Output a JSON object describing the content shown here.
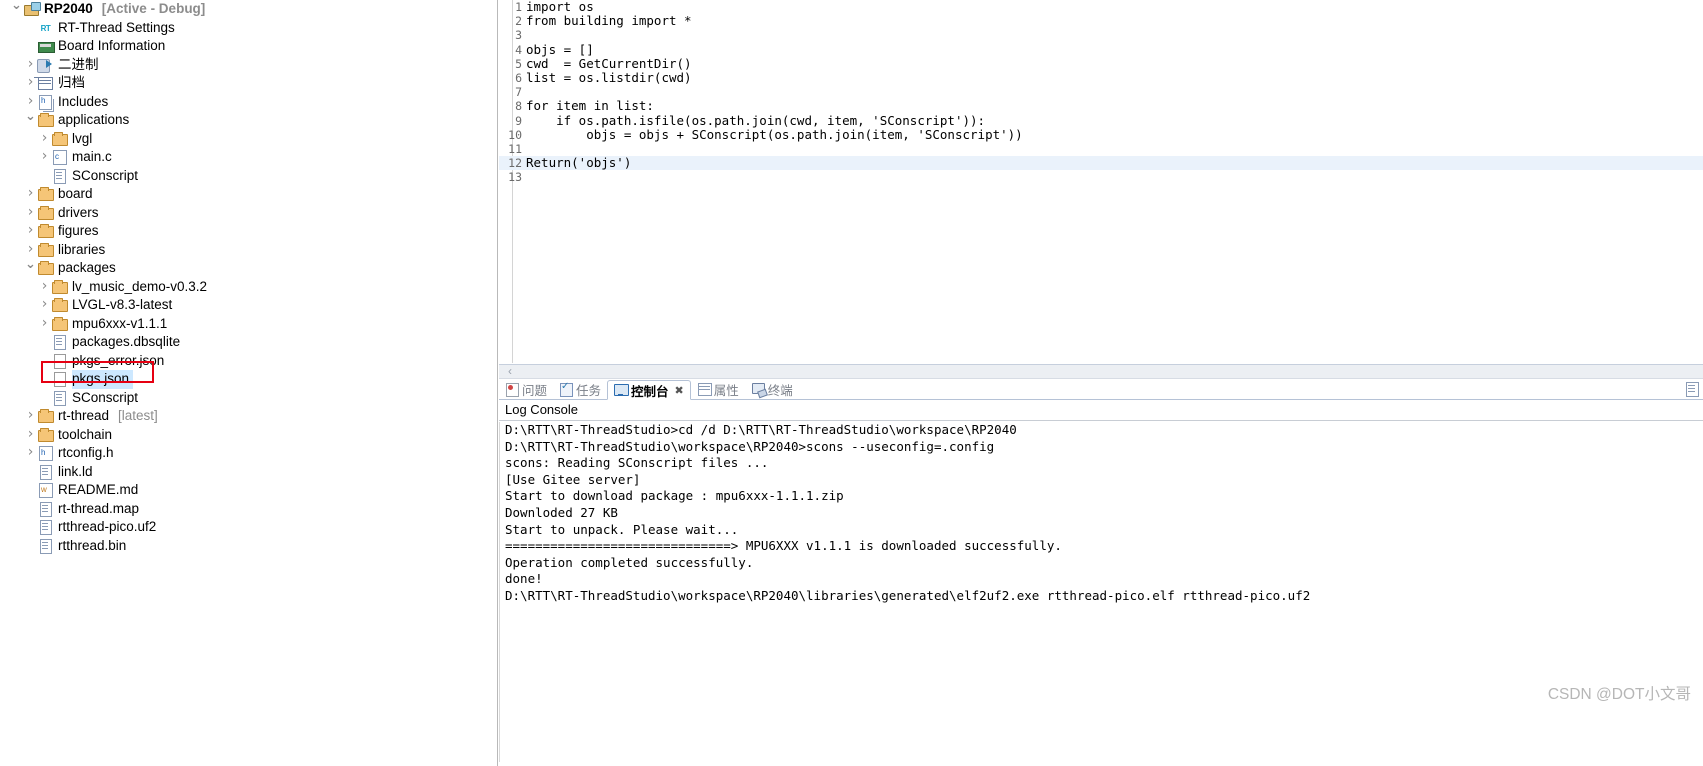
{
  "explorer": {
    "nodes": [
      {
        "depth": 0,
        "arrow": "open",
        "icon": "project-icon",
        "label": "RP2040",
        "suffix": "[Active - Debug]",
        "bold": true,
        "selected": false
      },
      {
        "depth": 1,
        "arrow": "none",
        "icon": "rt-thread-icon",
        "label": "RT-Thread Settings",
        "suffix": "",
        "bold": false,
        "selected": false
      },
      {
        "depth": 1,
        "arrow": "none",
        "icon": "board-icon",
        "label": "Board Information",
        "suffix": "",
        "bold": false,
        "selected": false
      },
      {
        "depth": 1,
        "arrow": "closed",
        "icon": "binary-icon",
        "label": "二进制",
        "suffix": "",
        "bold": false,
        "selected": false
      },
      {
        "depth": 1,
        "arrow": "closed",
        "icon": "archive-icon",
        "label": "归档",
        "suffix": "",
        "bold": false,
        "selected": false
      },
      {
        "depth": 1,
        "arrow": "closed",
        "icon": "includes-icon",
        "label": "Includes",
        "suffix": "",
        "bold": false,
        "selected": false
      },
      {
        "depth": 1,
        "arrow": "open",
        "icon": "folder-icon",
        "label": "applications",
        "suffix": "",
        "bold": false,
        "selected": false
      },
      {
        "depth": 2,
        "arrow": "closed",
        "icon": "folder-icon",
        "label": "lvgl",
        "suffix": "",
        "bold": false,
        "selected": false
      },
      {
        "depth": 2,
        "arrow": "closed",
        "icon": "c-file-icon",
        "label": "main.c",
        "suffix": "",
        "bold": false,
        "selected": false
      },
      {
        "depth": 2,
        "arrow": "none",
        "icon": "file-icon",
        "label": "SConscript",
        "suffix": "",
        "bold": false,
        "selected": false
      },
      {
        "depth": 1,
        "arrow": "closed",
        "icon": "folder-icon",
        "label": "board",
        "suffix": "",
        "bold": false,
        "selected": false
      },
      {
        "depth": 1,
        "arrow": "closed",
        "icon": "folder-icon",
        "label": "drivers",
        "suffix": "",
        "bold": false,
        "selected": false
      },
      {
        "depth": 1,
        "arrow": "closed",
        "icon": "folder-icon",
        "label": "figures",
        "suffix": "",
        "bold": false,
        "selected": false
      },
      {
        "depth": 1,
        "arrow": "closed",
        "icon": "folder-icon",
        "label": "libraries",
        "suffix": "",
        "bold": false,
        "selected": false
      },
      {
        "depth": 1,
        "arrow": "open",
        "icon": "folder-icon",
        "label": "packages",
        "suffix": "",
        "bold": false,
        "selected": false
      },
      {
        "depth": 2,
        "arrow": "closed",
        "icon": "folder-icon",
        "label": "lv_music_demo-v0.3.2",
        "suffix": "",
        "bold": false,
        "selected": false
      },
      {
        "depth": 2,
        "arrow": "closed",
        "icon": "folder-icon",
        "label": "LVGL-v8.3-latest",
        "suffix": "",
        "bold": false,
        "selected": false
      },
      {
        "depth": 2,
        "arrow": "closed",
        "icon": "folder-icon",
        "label": "mpu6xxx-v1.1.1",
        "suffix": "",
        "bold": false,
        "selected": false
      },
      {
        "depth": 2,
        "arrow": "none",
        "icon": "file-icon",
        "label": "packages.dbsqlite",
        "suffix": "",
        "bold": false,
        "selected": false
      },
      {
        "depth": 2,
        "arrow": "none",
        "icon": "plain-file-icon",
        "label": "pkgs_error.json",
        "suffix": "",
        "bold": false,
        "selected": false
      },
      {
        "depth": 2,
        "arrow": "none",
        "icon": "plain-file-icon",
        "label": "pkgs.json",
        "suffix": "",
        "bold": false,
        "selected": true
      },
      {
        "depth": 2,
        "arrow": "none",
        "icon": "file-icon",
        "label": "SConscript",
        "suffix": "",
        "bold": false,
        "selected": false
      },
      {
        "depth": 1,
        "arrow": "closed",
        "icon": "folder-icon",
        "label": "rt-thread",
        "suffix": "[latest]",
        "bold": false,
        "selected": false
      },
      {
        "depth": 1,
        "arrow": "closed",
        "icon": "folder-icon",
        "label": "toolchain",
        "suffix": "",
        "bold": false,
        "selected": false
      },
      {
        "depth": 1,
        "arrow": "closed",
        "icon": "h-file-icon",
        "label": "rtconfig.h",
        "suffix": "",
        "bold": false,
        "selected": false
      },
      {
        "depth": 1,
        "arrow": "none",
        "icon": "file-icon",
        "label": "link.ld",
        "suffix": "",
        "bold": false,
        "selected": false
      },
      {
        "depth": 1,
        "arrow": "none",
        "icon": "w-file-icon",
        "label": "README.md",
        "suffix": "",
        "bold": false,
        "selected": false
      },
      {
        "depth": 1,
        "arrow": "none",
        "icon": "file-icon",
        "label": "rt-thread.map",
        "suffix": "",
        "bold": false,
        "selected": false
      },
      {
        "depth": 1,
        "arrow": "none",
        "icon": "file-icon",
        "label": "rtthread-pico.uf2",
        "suffix": "",
        "bold": false,
        "selected": false
      },
      {
        "depth": 1,
        "arrow": "none",
        "icon": "file-icon",
        "label": "rtthread.bin",
        "suffix": "",
        "bold": false,
        "selected": false
      }
    ],
    "highlight_target": "pkgs.json",
    "highlight_color": "#e60012"
  },
  "editor": {
    "lines": [
      {
        "number": "1",
        "text": "import os",
        "current": false
      },
      {
        "number": "2",
        "text": "from building import *",
        "current": false
      },
      {
        "number": "3",
        "text": "",
        "current": false
      },
      {
        "number": "4",
        "text": "objs = []",
        "current": false
      },
      {
        "number": "5",
        "text": "cwd  = GetCurrentDir()",
        "current": false
      },
      {
        "number": "6",
        "text": "list = os.listdir(cwd)",
        "current": false
      },
      {
        "number": "7",
        "text": "",
        "current": false
      },
      {
        "number": "8",
        "text": "for item in list:",
        "current": false
      },
      {
        "number": "9",
        "text": "    if os.path.isfile(os.path.join(cwd, item, 'SConscript')):",
        "current": false
      },
      {
        "number": "10",
        "text": "        objs = objs + SConscript(os.path.join(item, 'SConscript'))",
        "current": false
      },
      {
        "number": "11",
        "text": "",
        "current": false
      },
      {
        "number": "12",
        "text": "Return('objs')",
        "current": true
      },
      {
        "number": "13",
        "text": "",
        "current": false
      }
    ]
  },
  "console": {
    "scroll_chevron": "‹",
    "tabs": [
      {
        "label": "问题",
        "icon": "problems-icon",
        "active": false,
        "closable": false
      },
      {
        "label": "任务",
        "icon": "tasks-icon",
        "active": false,
        "closable": false
      },
      {
        "label": "控制台",
        "icon": "console-icon",
        "active": true,
        "closable": true
      },
      {
        "label": "属性",
        "icon": "properties-icon",
        "active": false,
        "closable": false
      },
      {
        "label": "终端",
        "icon": "terminal-icon",
        "active": false,
        "closable": false
      }
    ],
    "close_glyph": "✖",
    "title": "Log Console",
    "log": "D:\\RTT\\RT-ThreadStudio>cd /d D:\\RTT\\RT-ThreadStudio\\workspace\\RP2040\nD:\\RTT\\RT-ThreadStudio\\workspace\\RP2040>scons --useconfig=.config\nscons: Reading SConscript files ...\n[Use Gitee server]\nStart to download package : mpu6xxx-1.1.1.zip\nDownloded 27 KB\nStart to unpack. Please wait...\n==============================> MPU6XXX v1.1.1 is downloaded successfully.\nOperation completed successfully.\ndone!\nD:\\RTT\\RT-ThreadStudio\\workspace\\RP2040\\libraries\\generated\\elf2uf2.exe rtthread-pico.elf rtthread-pico.uf2"
  },
  "watermark": {
    "text": "CSDN @DOT小文哥"
  }
}
